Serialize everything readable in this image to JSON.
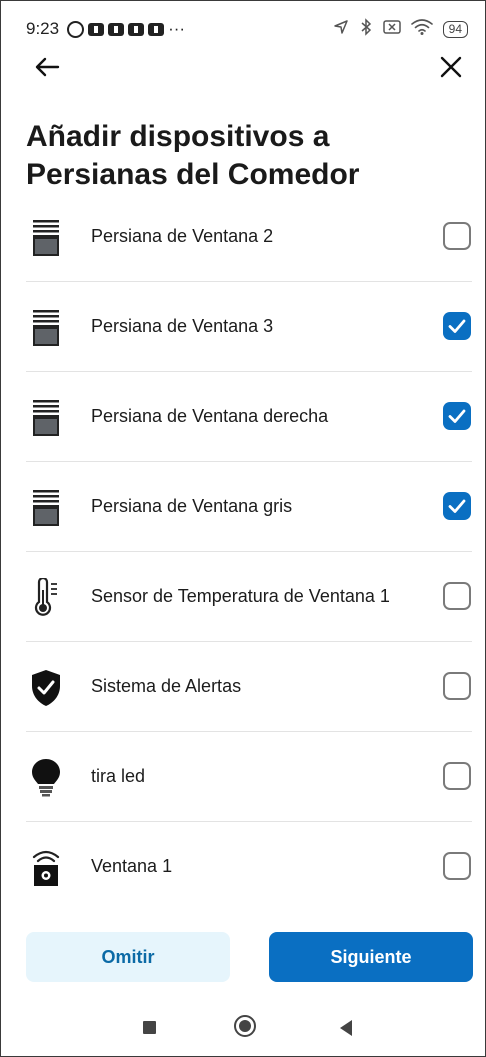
{
  "status_bar": {
    "time": "9:23",
    "more": "···",
    "battery": "94"
  },
  "header": {
    "title": "Añadir dispositivos a Persianas del Comedor"
  },
  "devices": [
    {
      "label": "Persiana de Ventana 2",
      "icon": "blind-icon",
      "checked": false
    },
    {
      "label": "Persiana de Ventana 3",
      "icon": "blind-icon",
      "checked": true
    },
    {
      "label": "Persiana de Ventana derecha",
      "icon": "blind-icon",
      "checked": true
    },
    {
      "label": "Persiana de Ventana gris",
      "icon": "blind-icon",
      "checked": true
    },
    {
      "label": "Sensor de Temperatura de Ventana 1",
      "icon": "thermometer-icon",
      "checked": false
    },
    {
      "label": "Sistema de Alertas",
      "icon": "shield-check-icon",
      "checked": false
    },
    {
      "label": "tira led",
      "icon": "bulb-icon",
      "checked": false
    },
    {
      "label": "Ventana 1",
      "icon": "contact-sensor-icon",
      "checked": false
    }
  ],
  "actions": {
    "skip_label": "Omitir",
    "next_label": "Siguiente"
  },
  "colors": {
    "accent": "#0a6fc2",
    "skip_bg": "#e6f5fc",
    "skip_text": "#0b6aa6"
  }
}
